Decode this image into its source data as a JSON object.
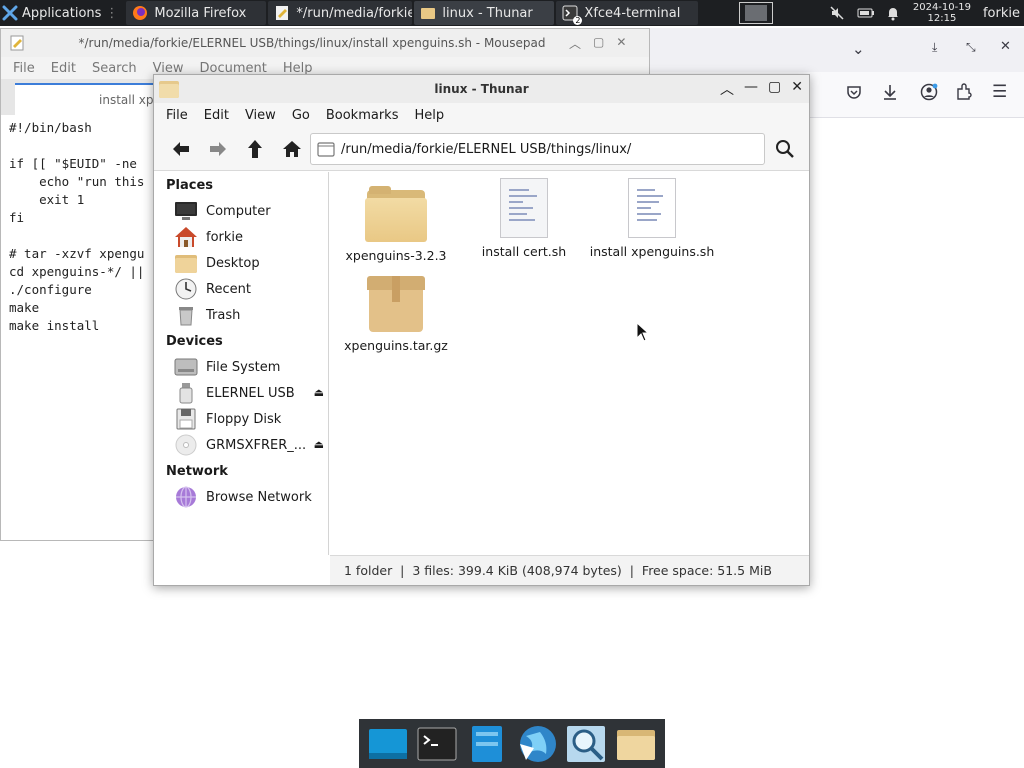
{
  "panel": {
    "applications_label": "Applications",
    "tasks": [
      {
        "label": "Mozilla Firefox"
      },
      {
        "label": "*/run/media/forkie/..."
      },
      {
        "label": "linux - Thunar"
      },
      {
        "label": "Xfce4-terminal"
      }
    ],
    "terminal_badge": "2",
    "clock_date": "2024-10-19",
    "clock_time": "12:15",
    "user": "forkie"
  },
  "mousepad": {
    "title": "*/run/media/forkie/ELERNEL USB/things/linux/install xpenguins.sh - Mousepad",
    "menu": [
      "File",
      "Edit",
      "Search",
      "View",
      "Document",
      "Help"
    ],
    "tab_label": "install xpe",
    "lines": [
      "#!/bin/bash",
      "",
      "if [[ \"$EUID\" -ne",
      "    echo \"run this",
      "    exit 1",
      "fi",
      "",
      "# tar -xzvf xpengu",
      "cd xpenguins-*/ ||",
      "./configure",
      "make",
      "make install"
    ]
  },
  "thunar": {
    "title": "linux - Thunar",
    "menu": [
      "File",
      "Edit",
      "View",
      "Go",
      "Bookmarks",
      "Help"
    ],
    "path": "/run/media/forkie/ELERNEL USB/things/linux/",
    "places_header": "Places",
    "places": [
      "Computer",
      "forkie",
      "Desktop",
      "Recent",
      "Trash"
    ],
    "devices_header": "Devices",
    "devices": [
      "File System",
      "ELERNEL USB",
      "Floppy Disk",
      "GRMSXFRER_..."
    ],
    "network_header": "Network",
    "network": [
      "Browse Network"
    ],
    "files": [
      "xpenguins-3.2.3",
      "install cert.sh",
      "install xpenguins.sh",
      "xpenguins.tar.gz"
    ],
    "status": "1 folder  |  3 files: 399.4 KiB (408,974 bytes)  |  Free space: 51.5 MiB"
  },
  "colors": {
    "panel_bg": "#1d1f22",
    "folder": "#e9c885",
    "accent": "#3c7dd9"
  }
}
